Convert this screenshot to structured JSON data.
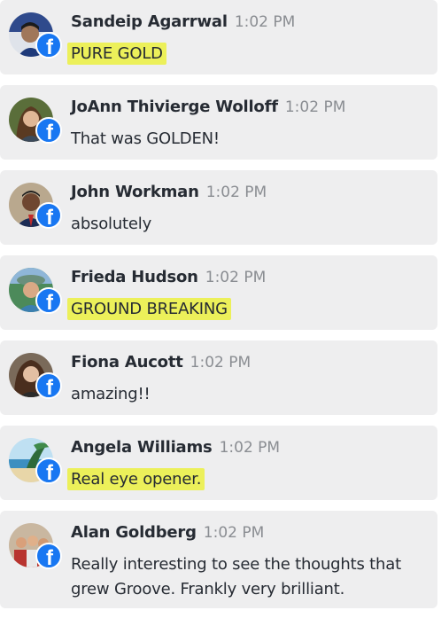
{
  "feed": {
    "comments": [
      {
        "name": "Sandeip Agarrwal",
        "time": "1:02 PM",
        "text": "PURE GOLD",
        "highlighted": true,
        "avatar": "man-avatar-photo"
      },
      {
        "name": "JoAnn Thivierge Wolloff",
        "time": "1:02 PM",
        "text": "That was GOLDEN!",
        "highlighted": false,
        "avatar": "woman-avatar-photo"
      },
      {
        "name": "John Workman",
        "time": "1:02 PM",
        "text": "absolutely",
        "highlighted": false,
        "avatar": "man-avatar-photo"
      },
      {
        "name": "Frieda Hudson",
        "time": "1:02 PM",
        "text": "GROUND BREAKING",
        "highlighted": true,
        "avatar": "woman-avatar-photo"
      },
      {
        "name": "Fiona Aucott",
        "time": "1:02 PM",
        "text": "amazing!!",
        "highlighted": false,
        "avatar": "woman-avatar-photo"
      },
      {
        "name": "Angela Williams",
        "time": "1:02 PM",
        "text": "Real eye opener.",
        "highlighted": true,
        "avatar": "beach-avatar-photo"
      },
      {
        "name": "Alan Goldberg",
        "time": "1:02 PM",
        "text": "Really interesting to see the thoughts that grew Groove. Frankly very brilliant.",
        "highlighted": false,
        "avatar": "group-avatar-photo"
      }
    ],
    "badge_icon": "facebook-icon",
    "badge_glyph": "f"
  },
  "colors": {
    "card_bg": "#eeeeef",
    "highlight": "#ecf05a",
    "facebook_blue": "#1877f2",
    "name_text": "#262b33",
    "time_text": "#8a8d92"
  }
}
